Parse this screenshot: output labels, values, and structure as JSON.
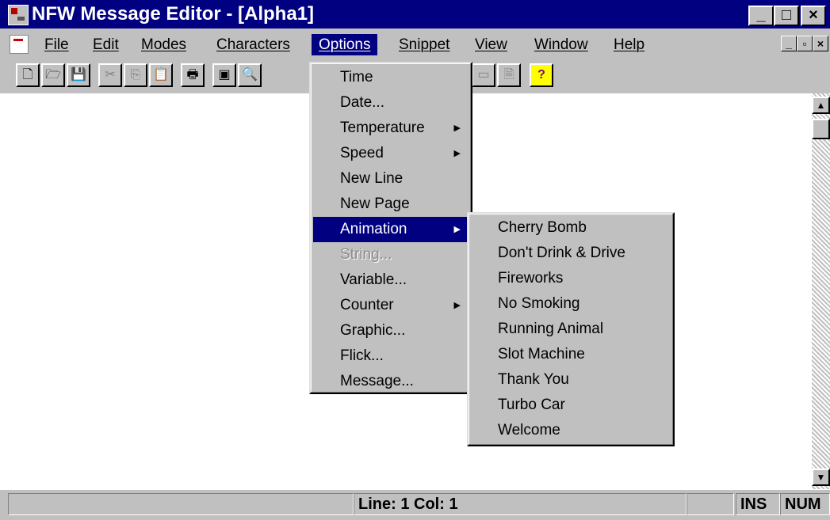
{
  "window": {
    "title": "NFW Message Editor - [Alpha1]",
    "caption_buttons": [
      "_",
      "□",
      "×"
    ],
    "mdi_buttons": [
      "_",
      "▫",
      "×"
    ]
  },
  "menubar": {
    "items": [
      {
        "label": "File"
      },
      {
        "label": "Edit"
      },
      {
        "label": "Modes"
      },
      {
        "label": "Characters"
      },
      {
        "label": "Options"
      },
      {
        "label": "Snippet"
      },
      {
        "label": "View"
      },
      {
        "label": "Window"
      },
      {
        "label": "Help"
      }
    ],
    "active": "Options"
  },
  "toolbar": {
    "buttons": [
      {
        "icon": "new-document-icon",
        "glyph": "🗋"
      },
      {
        "icon": "open-folder-icon",
        "glyph": "🗁"
      },
      {
        "icon": "save-icon",
        "glyph": "💾"
      },
      {
        "icon": "cut-icon",
        "glyph": "✂"
      },
      {
        "icon": "copy-icon",
        "glyph": "⎘"
      },
      {
        "icon": "paste-icon",
        "glyph": "📋"
      },
      {
        "icon": "print-icon",
        "glyph": "🖶"
      },
      {
        "icon": "film-icon",
        "glyph": "▣"
      },
      {
        "icon": "zoom-icon",
        "glyph": "🔍"
      },
      {
        "icon": "page-icon",
        "glyph": "▭"
      },
      {
        "icon": "document-icon",
        "glyph": "🗎"
      },
      {
        "icon": "help-icon",
        "glyph": "?"
      }
    ]
  },
  "options_menu": {
    "items": [
      {
        "label": "Time",
        "submenu": false,
        "disabled": false
      },
      {
        "label": "Date...",
        "submenu": false,
        "disabled": false
      },
      {
        "label": "Temperature",
        "submenu": true,
        "disabled": false
      },
      {
        "label": "Speed",
        "submenu": true,
        "disabled": false
      },
      {
        "label": "New Line",
        "submenu": false,
        "disabled": false
      },
      {
        "label": "New Page",
        "submenu": false,
        "disabled": false
      },
      {
        "label": "Animation",
        "submenu": true,
        "disabled": false,
        "selected": true
      },
      {
        "label": "String...",
        "submenu": false,
        "disabled": true
      },
      {
        "label": "Variable...",
        "submenu": false,
        "disabled": false
      },
      {
        "label": "Counter",
        "submenu": true,
        "disabled": false
      },
      {
        "label": "Graphic...",
        "submenu": false,
        "disabled": false
      },
      {
        "label": "Flick...",
        "submenu": false,
        "disabled": false
      },
      {
        "label": "Message...",
        "submenu": false,
        "disabled": false
      }
    ]
  },
  "animation_menu": {
    "items": [
      {
        "label": "Cherry Bomb"
      },
      {
        "label": "Don't Drink & Drive"
      },
      {
        "label": "Fireworks"
      },
      {
        "label": "No Smoking"
      },
      {
        "label": "Running Animal"
      },
      {
        "label": "Slot Machine"
      },
      {
        "label": "Thank You"
      },
      {
        "label": "Turbo Car"
      },
      {
        "label": "Welcome"
      }
    ]
  },
  "statusbar": {
    "position": "Line: 1   Col: 1",
    "ins": "INS",
    "num": "NUM"
  },
  "scrollbar": {
    "up": "▲",
    "down": "▼"
  },
  "colors": {
    "titlebar": "#000080",
    "highlight": "#000080",
    "face": "#c0c0c0"
  }
}
